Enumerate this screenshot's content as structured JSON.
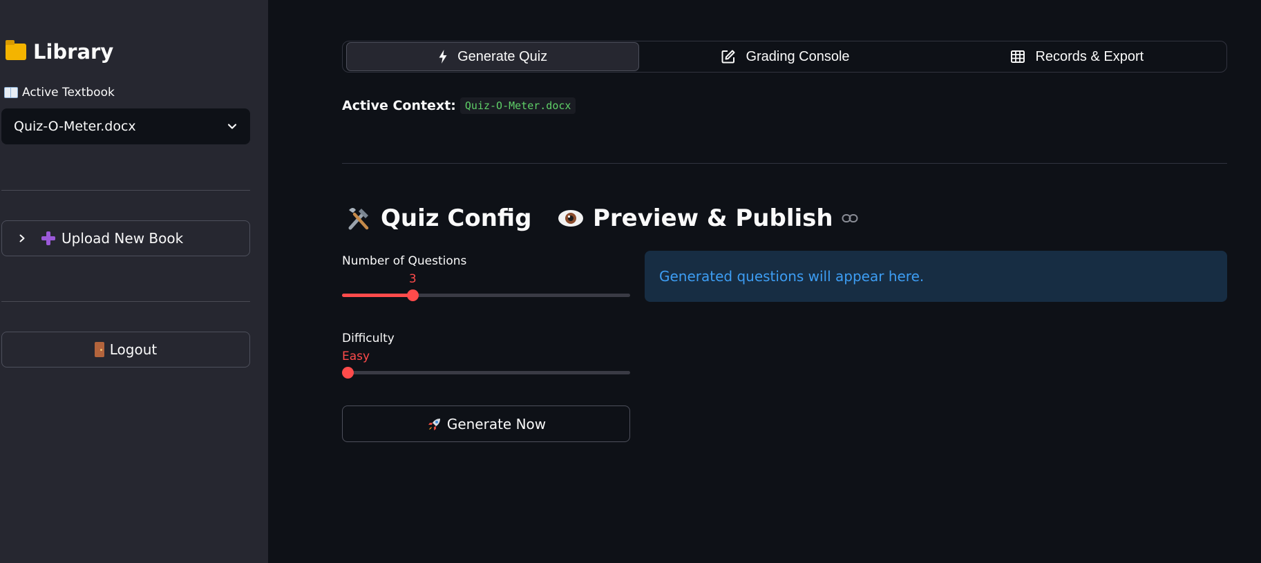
{
  "sidebar": {
    "title": "Library",
    "active_label": "Active Textbook",
    "selected_book": "Quiz-O-Meter.docx",
    "upload_label": "Upload New Book",
    "logout_label": "Logout"
  },
  "tabs": [
    {
      "label": "Generate Quiz",
      "icon": "bolt-icon",
      "active": true
    },
    {
      "label": "Grading Console",
      "icon": "edit-icon",
      "active": false
    },
    {
      "label": "Records & Export",
      "icon": "table-icon",
      "active": false
    }
  ],
  "context": {
    "label": "Active Context:",
    "value": "Quiz-O-Meter.docx"
  },
  "quiz_config": {
    "title": "Quiz Config",
    "num_questions_label": "Number of Questions",
    "num_questions_value": "3",
    "num_questions_fraction": 0.235,
    "difficulty_label": "Difficulty",
    "difficulty_value": "Easy",
    "difficulty_fraction": 0.0,
    "generate_label": "Generate Now"
  },
  "preview": {
    "title": "Preview & Publish",
    "empty_message": "Generated questions will appear here."
  },
  "colors": {
    "accent": "#ff4b4b",
    "background": "#0e1117",
    "sidebar": "#262730",
    "info": "#3d9df3"
  }
}
